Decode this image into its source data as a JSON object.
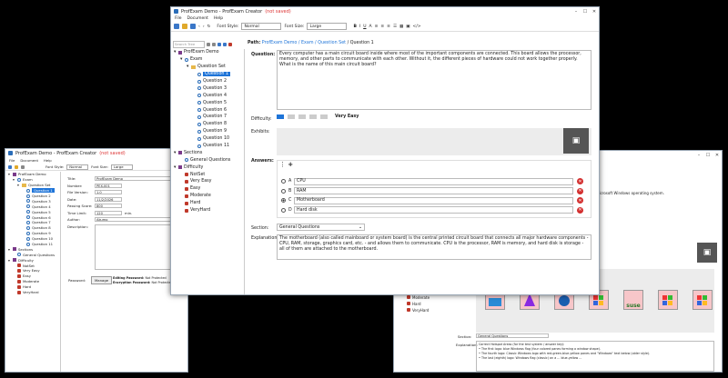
{
  "main": {
    "app": "ProfExam Demo",
    "editor": "ProfExam Creator",
    "unsaved": "(not saved)",
    "menu": [
      "File",
      "Document",
      "Help"
    ],
    "font_style_label": "Font Style:",
    "font_style_value": "Normal",
    "font_size_label": "Font Size:",
    "font_size_value": "Large",
    "search_placeholder": "Search Tree",
    "path_label": "Path:",
    "path_links": "ProfExam Demo / Exam / Question Set",
    "path_current": "/ Question 1",
    "tree": [
      "ProfExam Demo",
      "Exam",
      "Question Set",
      "Question 1",
      "Question 2",
      "Question 3",
      "Question 4",
      "Question 5",
      "Question 6",
      "Question 7",
      "Question 8",
      "Question 9",
      "Question 10",
      "Question 11",
      "Sections",
      "General Questions",
      "Difficulty",
      "NotSet",
      "Very Easy",
      "Easy",
      "Moderate",
      "Hard",
      "VeryHard"
    ],
    "question_label": "Question:",
    "question_text": "Every computer has a main circuit board inside where most of the important components are connected. This board allows the processor, memory, and other parts to communicate with each other. Without it, the different pieces of hardware could not work together properly.",
    "question_prompt": "What is the name of this main circuit board?",
    "difficulty_label": "Difficulty:",
    "difficulty_value": "Very Easy",
    "exhibits_label": "Exhibits:",
    "answers_label": "Answers:",
    "answers": [
      {
        "letter": "A",
        "text": "CPU",
        "correct": false
      },
      {
        "letter": "B",
        "text": "RAM",
        "correct": false
      },
      {
        "letter": "C",
        "text": "Motherboard",
        "correct": true
      },
      {
        "letter": "D",
        "text": "Hard disk",
        "correct": false
      }
    ],
    "section_label": "Section:",
    "section_value": "General Questions",
    "explanation_label": "Explanation:",
    "explanation_text": "The motherboard (also called mainboard or system board) is the central printed circuit board that connects all major hardware components - CPU, RAM, storage, graphics card, etc. - and allows them to communicate. CPU is the processor, RAM is memory, and hard disk is storage - all of them are attached to the motherboard."
  },
  "left": {
    "title_app": "ProfExam Demo",
    "title_editor": "ProfExam Creator",
    "unsaved": "(not saved)",
    "menu": [
      "File",
      "Document",
      "Help"
    ],
    "font_style_label": "Font Style:",
    "font_style_value": "Normal",
    "font_size_label": "Font Size:",
    "font_size_value": "Large",
    "tree": [
      "ProfExam Demo",
      "Exam",
      "Question Set",
      "Question 1",
      "Question 2",
      "Question 3",
      "Question 4",
      "Question 5",
      "Question 6",
      "Question 7",
      "Question 8",
      "Question 9",
      "Question 10",
      "Question 11",
      "Sections",
      "General Questions",
      "Difficulty",
      "NotSet",
      "Very Easy",
      "Easy",
      "Moderate",
      "Hard",
      "VeryHard"
    ],
    "fields": [
      {
        "label": "Title:",
        "value": "ProfExam Demo"
      },
      {
        "label": "Number:",
        "value": "PEX-001"
      },
      {
        "label": "File Version:",
        "value": "1.0"
      },
      {
        "label": "Date:",
        "value": "11/2/2026"
      },
      {
        "label": "Passing Score:",
        "value": "800"
      },
      {
        "label": "Time Limit:",
        "value": "120"
      },
      {
        "label": "Author:",
        "value": "Akumo"
      },
      {
        "label": "Description:",
        "value": ""
      }
    ],
    "time_unit": "min.",
    "password_label": "Password:",
    "manage_label": "Manage",
    "editing_pw": "Editing Password:",
    "editing_pw_value": "Not Protected",
    "encryption_pw": "Encryption Password:",
    "encryption_pw_value": "Not Protected"
  },
  "right": {
    "question_fragment": "Microsoft Windows operating system.",
    "tree_tail": [
      "Moderate",
      "Hard",
      "VeryHard"
    ],
    "section_label": "Section:",
    "section_value": "General Questions",
    "explanation_label": "Explanation:",
    "explanation_lines": [
      "Correct Hotspot Areas (for the test system / answer key):",
      "• The first logo: blue Windows flag (four colored panes forming a window shape).",
      "• The fourth logo: Classic Windows logo with red-green-blue-yellow panes and \"Windows\" text below (older style).",
      "• The last (eighth) logo: Windows flag (classic) on a ... blue-yellow ..."
    ],
    "tile_brand": "suse"
  }
}
